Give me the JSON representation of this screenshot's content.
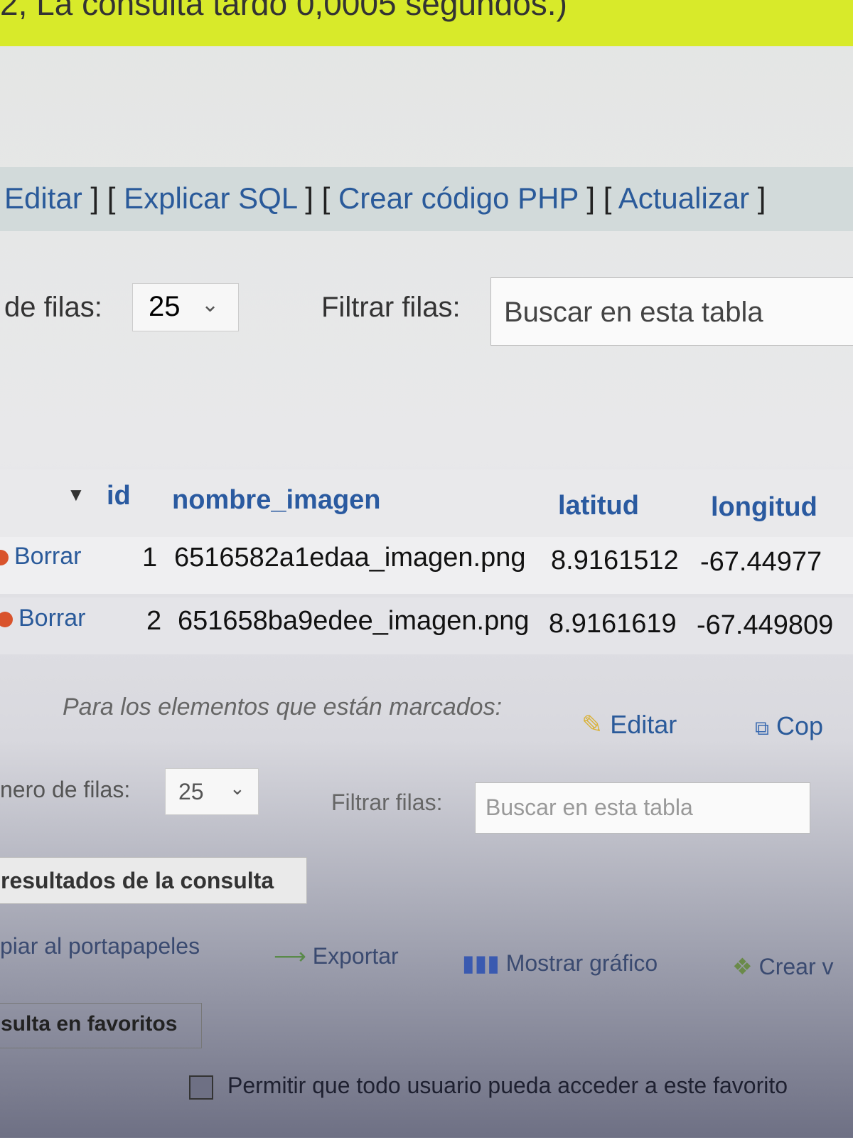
{
  "status": {
    "message": "2, La consulta tardó 0,0005 segundos.)"
  },
  "links": {
    "editar": "Editar",
    "explicar": "Explicar SQL",
    "php": "Crear código PHP",
    "actualizar": "Actualizar"
  },
  "filter_top": {
    "rows_label": "de filas:",
    "rows_value": "25",
    "filter_label": "Filtrar filas:",
    "placeholder": "Buscar en esta tabla"
  },
  "table": {
    "columns": [
      "id",
      "nombre_imagen",
      "latitud",
      "longitud"
    ],
    "delete_label": "Borrar",
    "rows": [
      {
        "id": "1",
        "nombre_imagen": "6516582a1edaa_imagen.png",
        "latitud": "8.9161512",
        "longitud": "-67.44977"
      },
      {
        "id": "2",
        "nombre_imagen": "651658ba9edee_imagen.png",
        "latitud": "8.9161619",
        "longitud": "-67.449809"
      }
    ]
  },
  "marked": {
    "label": "Para los elementos que están marcados:",
    "edit": "Editar",
    "copy": "Cop"
  },
  "filter_bottom": {
    "rows_label": "nero de filas:",
    "rows_value": "25",
    "filter_label": "Filtrar filas:",
    "placeholder": "Buscar en esta tabla"
  },
  "results_ops": {
    "title": "resultados de la consulta",
    "copy": "piar al portapapeles",
    "export": "Exportar",
    "chart": "Mostrar gráfico",
    "create_view": "Crear v"
  },
  "bookmark": {
    "title": "sulta en favoritos",
    "allow_all": "Permitir que todo usuario pueda acceder a este favorito"
  }
}
